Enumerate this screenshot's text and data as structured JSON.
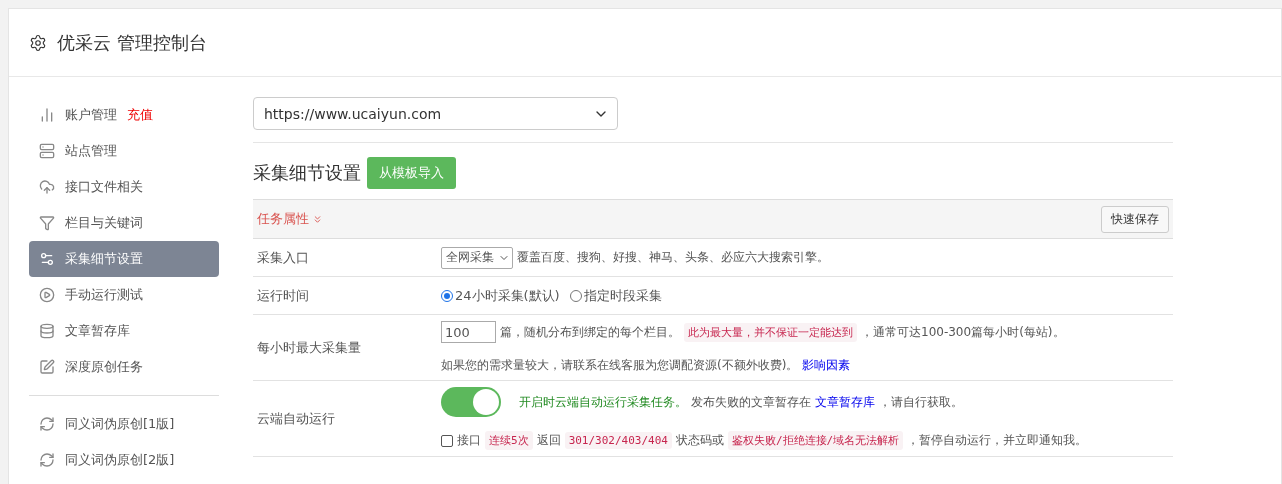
{
  "header": {
    "title": "优采云 管理控制台"
  },
  "sidebar": {
    "groups": [
      [
        {
          "label": "账户管理",
          "badge": "充值",
          "selected": false
        },
        {
          "label": "站点管理",
          "selected": false
        },
        {
          "label": "接口文件相关",
          "selected": false
        },
        {
          "label": "栏目与关键词",
          "selected": false
        },
        {
          "label": "采集细节设置",
          "selected": true
        },
        {
          "label": "手动运行测试",
          "selected": false
        },
        {
          "label": "文章暂存库",
          "selected": false
        },
        {
          "label": "深度原创任务",
          "selected": false
        }
      ],
      [
        {
          "label": "同义词伪原创[1版]",
          "selected": false
        },
        {
          "label": "同义词伪原创[2版]",
          "selected": false
        }
      ]
    ]
  },
  "site_select": {
    "value": "https://www.ucaiyun.com"
  },
  "section": {
    "title": "采集细节设置",
    "import_button": "从模板导入"
  },
  "panel": {
    "title": "任务属性",
    "save_button": "快速保存",
    "rows": [
      {
        "kind": "select",
        "label": "采集入口",
        "select": "全网采集",
        "lines": [
          [
            {
              "kind": "text",
              "text": "覆盖百度、搜狗、好搜、神马、头条、必应六大搜索引擎。"
            }
          ]
        ]
      },
      {
        "kind": "radios",
        "label": "运行时间",
        "options": [
          {
            "label": "24小时采集(默认)",
            "selected": true
          },
          {
            "label": "指定时段采集",
            "selected": false
          }
        ]
      },
      {
        "kind": "number",
        "label": "每小时最大采集量",
        "value": "100",
        "lines": [
          [
            {
              "kind": "text",
              "text": "篇，随机分布到绑定的每个栏目。"
            },
            {
              "kind": "code",
              "text": "此为最大量，并不保证一定能达到"
            },
            {
              "kind": "text",
              "text": "，通常可达100-300篇每小时(每站)。"
            }
          ],
          [
            {
              "kind": "text",
              "text": "如果您的需求量较大，请联系在线客服为您调配资源(不额外收费)。"
            },
            {
              "kind": "link",
              "text": "影响因素"
            }
          ]
        ]
      },
      {
        "kind": "switch",
        "label": "云端自动运行",
        "on": true,
        "checked": false,
        "lines": [
          [
            {
              "kind": "note",
              "text": "开启时云端自动运行采集任务。"
            },
            {
              "kind": "text",
              "text": "发布失败的文章暂存在"
            },
            {
              "kind": "link",
              "text": "文章暂存库"
            },
            {
              "kind": "text",
              "text": "，请自行获取。"
            }
          ],
          [
            {
              "kind": "text",
              "text": "接口"
            },
            {
              "kind": "code",
              "text": "连续5次"
            },
            {
              "kind": "text",
              "text": "返回"
            },
            {
              "kind": "code",
              "text": "301/302/403/404"
            },
            {
              "kind": "text",
              "text": "状态码或"
            },
            {
              "kind": "code",
              "text": "鉴权失败/拒绝连接/域名无法解析"
            },
            {
              "kind": "text",
              "text": "，暂停自动运行，并立即通知我。"
            }
          ]
        ]
      }
    ]
  }
}
